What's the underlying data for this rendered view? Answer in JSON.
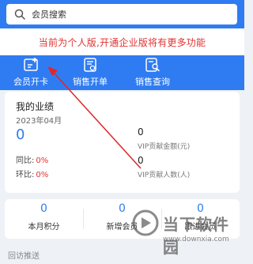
{
  "search": {
    "placeholder": "会员搜索",
    "icon": "search-icon"
  },
  "notice": {
    "text": "当前为个人版,开通企业版将有更多功能"
  },
  "actions": [
    {
      "label": "会员开卡",
      "icon": "member-card-add-icon"
    },
    {
      "label": "销售开单",
      "icon": "sales-order-icon"
    },
    {
      "label": "销售查询",
      "icon": "sales-query-icon"
    }
  ],
  "performance": {
    "title": "我的业绩",
    "date": "2023年04月",
    "value": "0",
    "yoy_label": "同比:",
    "yoy_value": "0%",
    "mom_label": "环比:",
    "mom_value": "0%",
    "vip_amount_value": "0",
    "vip_amount_label": "VIP贡献金额(元)",
    "vip_count_value": "0",
    "vip_count_label": "VIP贡献人数(人)"
  },
  "stats": [
    {
      "value": "0",
      "label": "本月积分"
    },
    {
      "value": "0",
      "label": "新增会员"
    },
    {
      "value": "0",
      "label": "跟进会员"
    }
  ],
  "section": {
    "title": "回访推送"
  },
  "watermark": {
    "name": "当下软件园",
    "url": "www.downxia.com"
  },
  "colors": {
    "primary": "#2f7cf2",
    "alert": "#e23232",
    "annotation": "#e0262a"
  }
}
